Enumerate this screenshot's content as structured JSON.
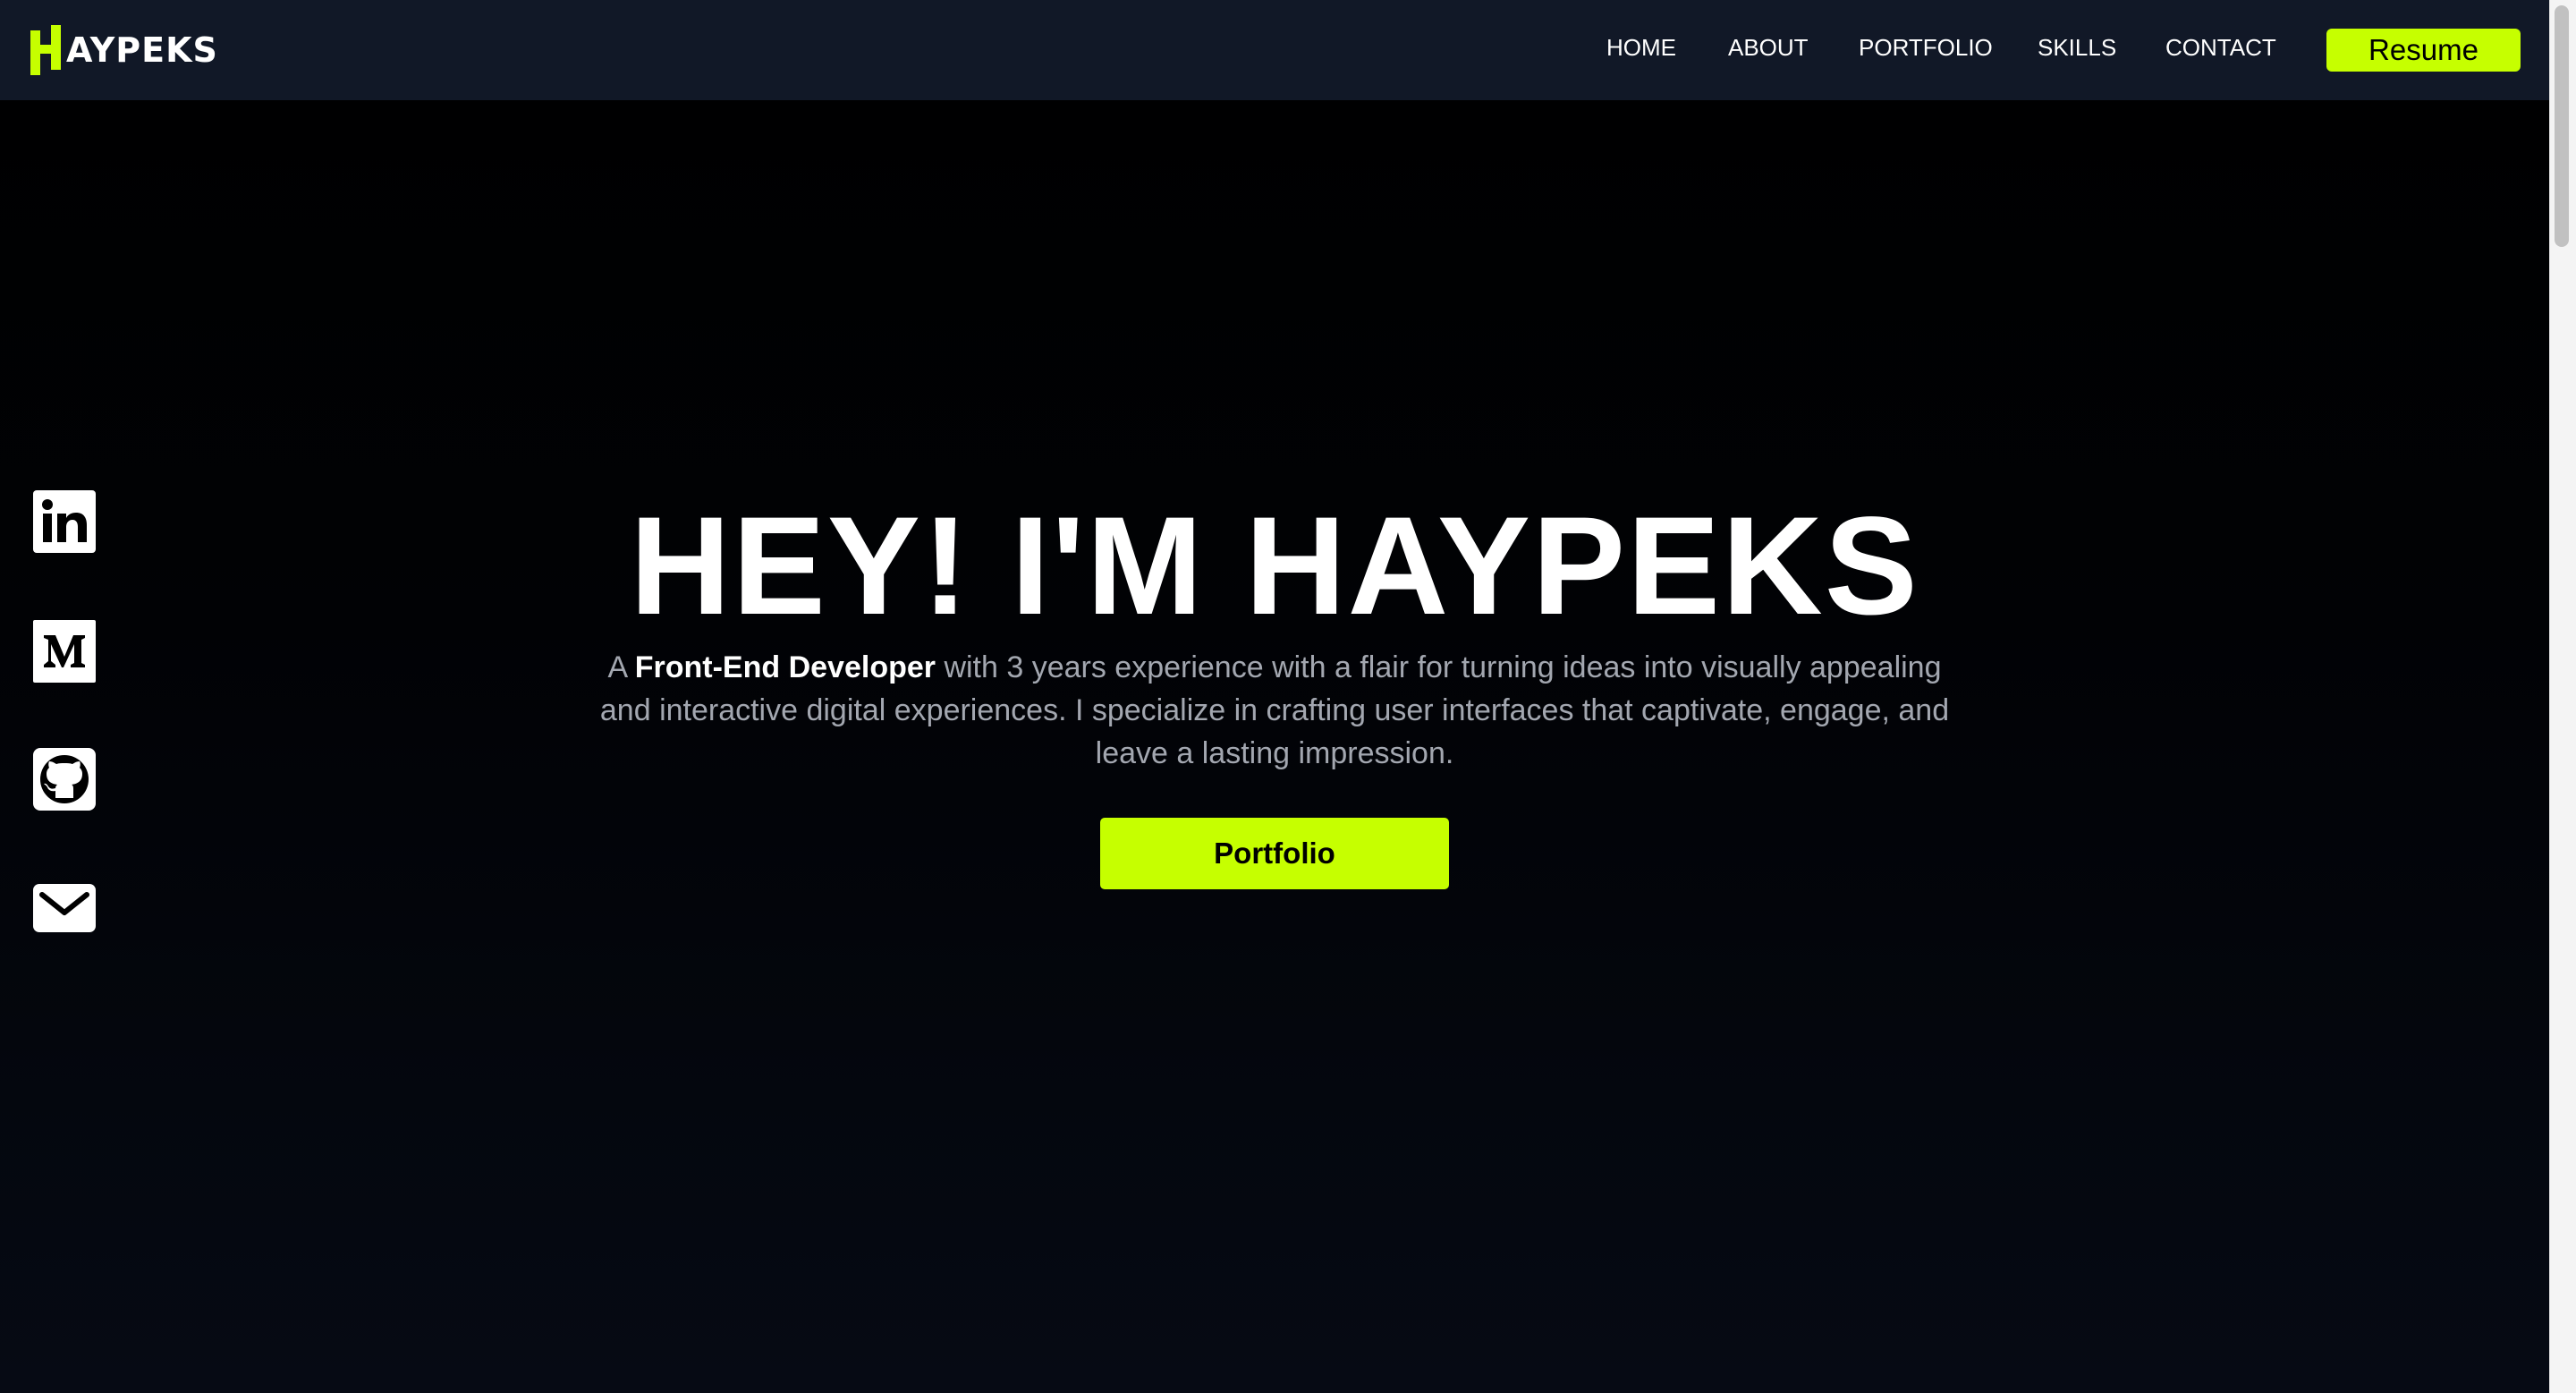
{
  "header": {
    "logo_text": "AYPEKS",
    "nav": [
      {
        "label": "HOME"
      },
      {
        "label": "ABOUT"
      },
      {
        "label": "PORTFOLIO"
      },
      {
        "label": "SKILLS"
      },
      {
        "label": "CONTACT"
      }
    ],
    "resume_label": "Resume"
  },
  "social": [
    {
      "name": "linkedin",
      "icon": "linkedin-icon"
    },
    {
      "name": "medium",
      "icon": "medium-icon"
    },
    {
      "name": "github",
      "icon": "github-icon"
    },
    {
      "name": "email",
      "icon": "mail-icon"
    }
  ],
  "hero": {
    "title": "HEY! I'M HAYPEKS",
    "description_prefix": "A ",
    "description_highlight": "Front-End Developer",
    "description_suffix": " with 3 years experience with a flair for turning ideas into visually appealing and interactive digital experiences. I specialize in crafting user interfaces that captivate, engage, and leave a lasting impression.",
    "cta_label": "Portfolio"
  },
  "colors": {
    "accent": "#c6ff00",
    "header_bg": "#111827",
    "page_bg": "#000000",
    "text_muted": "#a3a7b0"
  }
}
